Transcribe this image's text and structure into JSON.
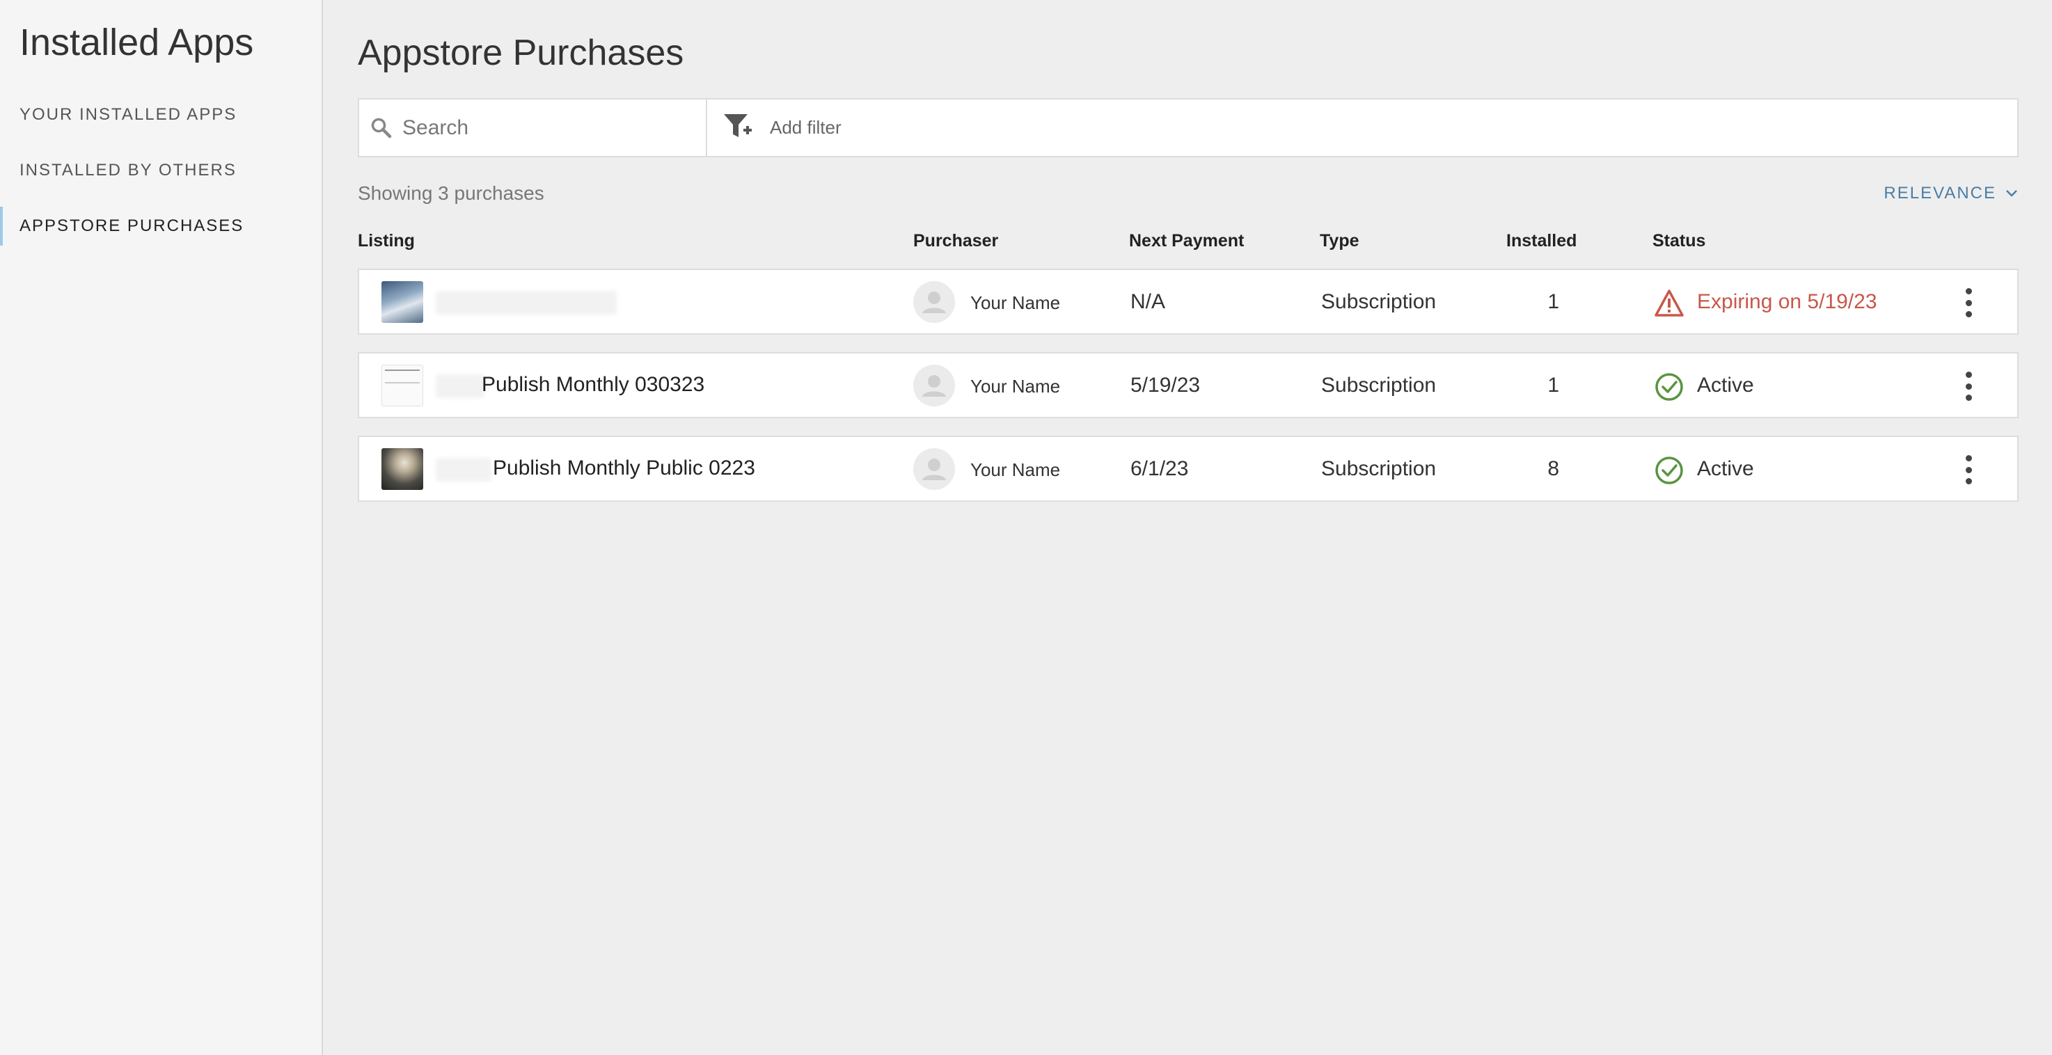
{
  "sidebar": {
    "title": "Installed Apps",
    "items": [
      {
        "label": "YOUR INSTALLED APPS",
        "active": false
      },
      {
        "label": "INSTALLED BY OTHERS",
        "active": false
      },
      {
        "label": "APPSTORE PURCHASES",
        "active": true
      }
    ],
    "active_indicator_color": "#9ec9e8"
  },
  "main": {
    "title": "Appstore Purchases",
    "search": {
      "placeholder": "Search",
      "value": ""
    },
    "filter": {
      "label": "Add filter"
    },
    "showing_text": "Showing 3 purchases",
    "sort": {
      "label": "RELEVANCE",
      "color": "#4a7ea6"
    },
    "columns": {
      "listing": "Listing",
      "purchaser": "Purchaser",
      "next_payment": "Next Payment",
      "type": "Type",
      "installed": "Installed",
      "status": "Status"
    },
    "rows": [
      {
        "listing_name": "",
        "purchaser": "Your Name",
        "next_payment": "N/A",
        "type": "Subscription",
        "installed": "1",
        "status": "Expiring on 5/19/23",
        "status_kind": "warning",
        "status_color": "#c9574a",
        "status_icon": "warning-triangle-icon"
      },
      {
        "listing_name": "Publish Monthly 030323",
        "purchaser": "Your Name",
        "next_payment": "5/19/23",
        "type": "Subscription",
        "installed": "1",
        "status": "Active",
        "status_kind": "ok",
        "status_color": "#5a9440",
        "status_icon": "check-circle-icon"
      },
      {
        "listing_name": "Publish Monthly Public 0223",
        "purchaser": "Your Name",
        "next_payment": "6/1/23",
        "type": "Subscription",
        "installed": "8",
        "status": "Active",
        "status_kind": "ok",
        "status_color": "#5a9440",
        "status_icon": "check-circle-icon"
      }
    ]
  }
}
